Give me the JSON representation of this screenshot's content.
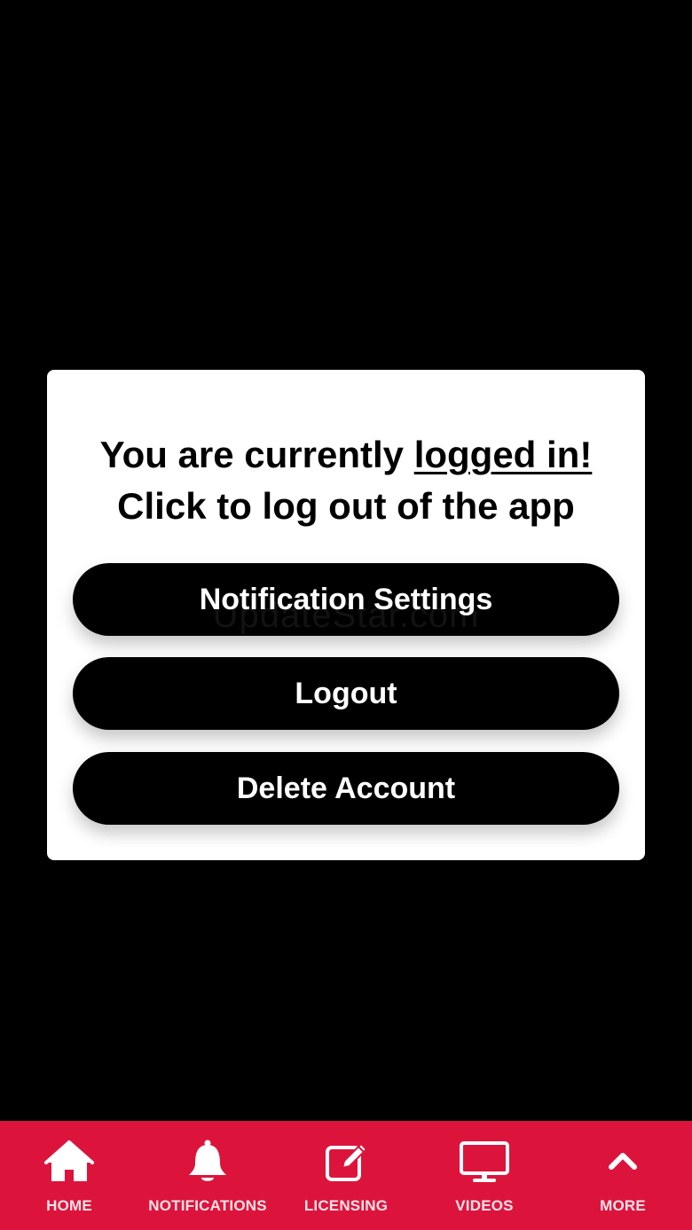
{
  "colors": {
    "background": "#000000",
    "card": "#ffffff",
    "accent": "#dc143c"
  },
  "dialog": {
    "line1_prefix": "You are currently ",
    "line1_emphasis": "logged in!",
    "line2": "Click to log out of the app",
    "buttons": {
      "notification_settings": "Notification Settings",
      "logout": "Logout",
      "delete_account": "Delete Account"
    }
  },
  "watermark": "UpdateStar.com",
  "tabbar": {
    "items": [
      {
        "label": "HOME",
        "icon": "home-icon"
      },
      {
        "label": "NOTIFICATIONS",
        "icon": "bell-icon"
      },
      {
        "label": "LICENSING",
        "icon": "edit-icon"
      },
      {
        "label": "VIDEOS",
        "icon": "monitor-icon"
      },
      {
        "label": "MORE",
        "icon": "chevron-up-icon"
      }
    ]
  }
}
